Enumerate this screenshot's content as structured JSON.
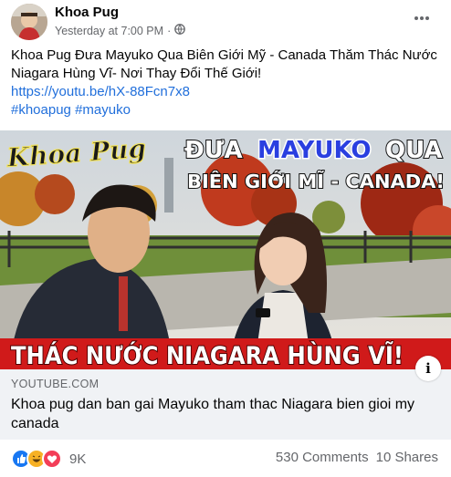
{
  "post": {
    "author": "Khoa Pug",
    "timestamp": "Yesterday at 7:00 PM",
    "separator": "·",
    "privacy_icon": "globe-icon",
    "more_icon": "more-horizontal-icon",
    "text_line1": "Khoa Pug Đưa Mayuko Qua Biên Giới Mỹ - Canada Thăm Thác Nước",
    "text_line2": "Niagara Hùng Vĩ- Nơi Thay Đổi Thế Giới!",
    "link": "https://youtu.be/hX-88Fcn7x8",
    "hashtags": "#khoapug #mayuko"
  },
  "thumbnail": {
    "logo_text": "Khoa Pug",
    "headline_word1": "ĐƯA",
    "headline_name": "MAYUKO",
    "headline_word2": "QUA",
    "headline_line2": "BIÊN GIỚI MĨ - CANADA!",
    "bottom_banner": "THÁC NƯỚC NIAGARA HÙNG VĨ!"
  },
  "link_preview": {
    "domain": "YOUTUBE.COM",
    "title": "Khoa pug dan ban gai Mayuko tham thac Niagara bien gioi my canada",
    "info_icon": "i"
  },
  "engagement": {
    "reaction_icons": [
      "like-icon",
      "haha-icon",
      "love-icon"
    ],
    "reaction_count": "9K",
    "comments": "530 Comments",
    "shares": "10 Shares"
  },
  "colors": {
    "link": "#216fdb",
    "meta_gray": "#65676b",
    "banner_red": "#d01a1a",
    "headline_blue": "#2a3fe0",
    "like_blue": "#1877f2",
    "haha_yellow": "#f7b125",
    "love_red": "#f33e58"
  }
}
